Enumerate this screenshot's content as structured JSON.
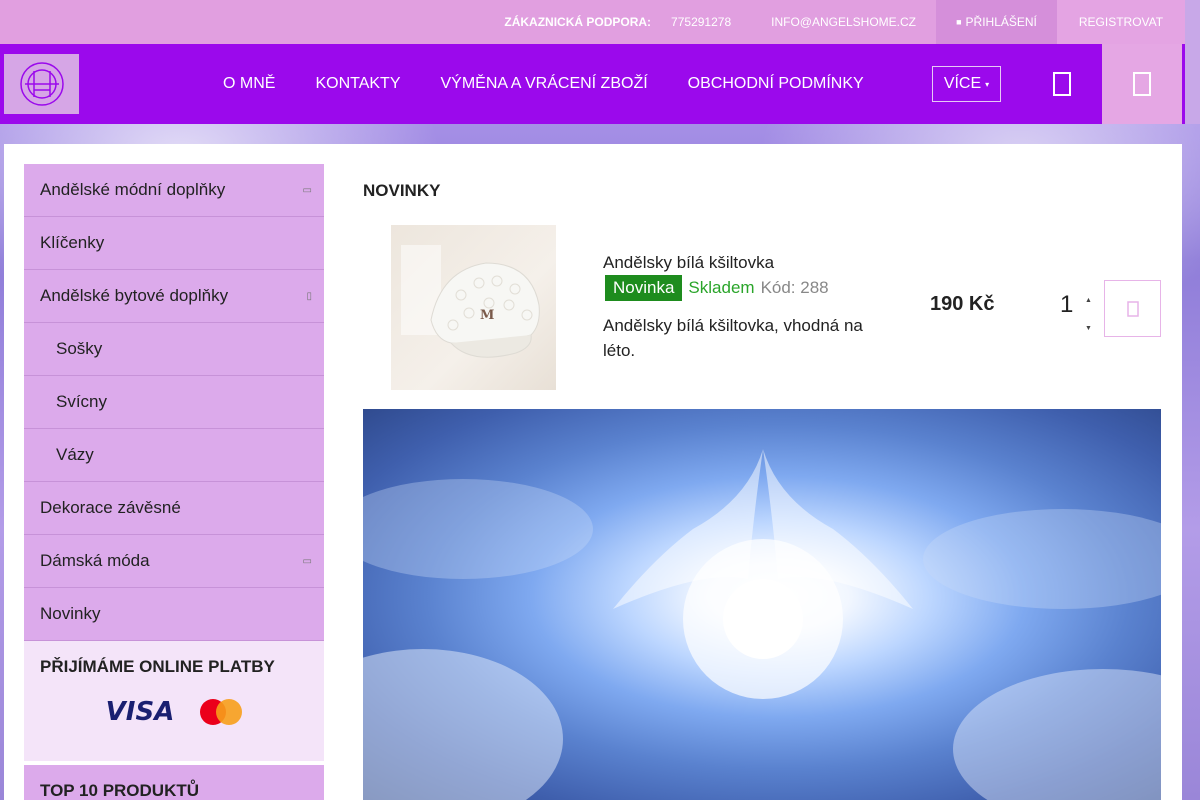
{
  "topbar": {
    "support_label": "ZÁKAZNICKÁ PODPORA:",
    "phone": "775291278",
    "email": "INFO@ANGELSHOME.CZ",
    "login": "PŘIHLÁŠENÍ",
    "register": "REGISTROVAT"
  },
  "nav": {
    "links": [
      "O MNĚ",
      "KONTAKTY",
      "VÝMĚNA A VRÁCENÍ ZBOŽÍ",
      "OBCHODNÍ PODMÍNKY"
    ],
    "more": "VÍCE"
  },
  "sidebar": {
    "categories": [
      {
        "label": "Andělské módní doplňky",
        "expandable": true
      },
      {
        "label": "Klíčenky",
        "expandable": false
      },
      {
        "label": "Andělské bytové doplňky",
        "expandable": true
      },
      {
        "label": "Sošky",
        "expandable": false,
        "sub": true
      },
      {
        "label": "Svícny",
        "expandable": false,
        "sub": true
      },
      {
        "label": "Vázy",
        "expandable": false,
        "sub": true
      },
      {
        "label": "Dekorace závěsné",
        "expandable": false
      },
      {
        "label": "Dámská móda",
        "expandable": true
      },
      {
        "label": "Novinky",
        "expandable": false
      }
    ],
    "payments_title": "PŘIJÍMÁME ONLINE PLATBY",
    "visa": "VISA",
    "top10_title": "TOP 10 PRODUKTŮ"
  },
  "main": {
    "section_title": "NOVINKY",
    "product": {
      "name": "Andělsky bílá kšiltovka",
      "badge": "Novinka",
      "stock": "Skladem",
      "code": "Kód: 288",
      "description": "Andělsky bílá kšiltovka, vhodná na léto.",
      "price": "190 Kč",
      "quantity": "1",
      "cap_logo": "M"
    }
  },
  "colors": {
    "nav_bg": "#9b09ec",
    "topbar_bg": "#e19fe0",
    "sidebar_bg": "#dcaaeb",
    "badge_green": "#1e8c1e",
    "stock_green": "#2aa52a"
  }
}
